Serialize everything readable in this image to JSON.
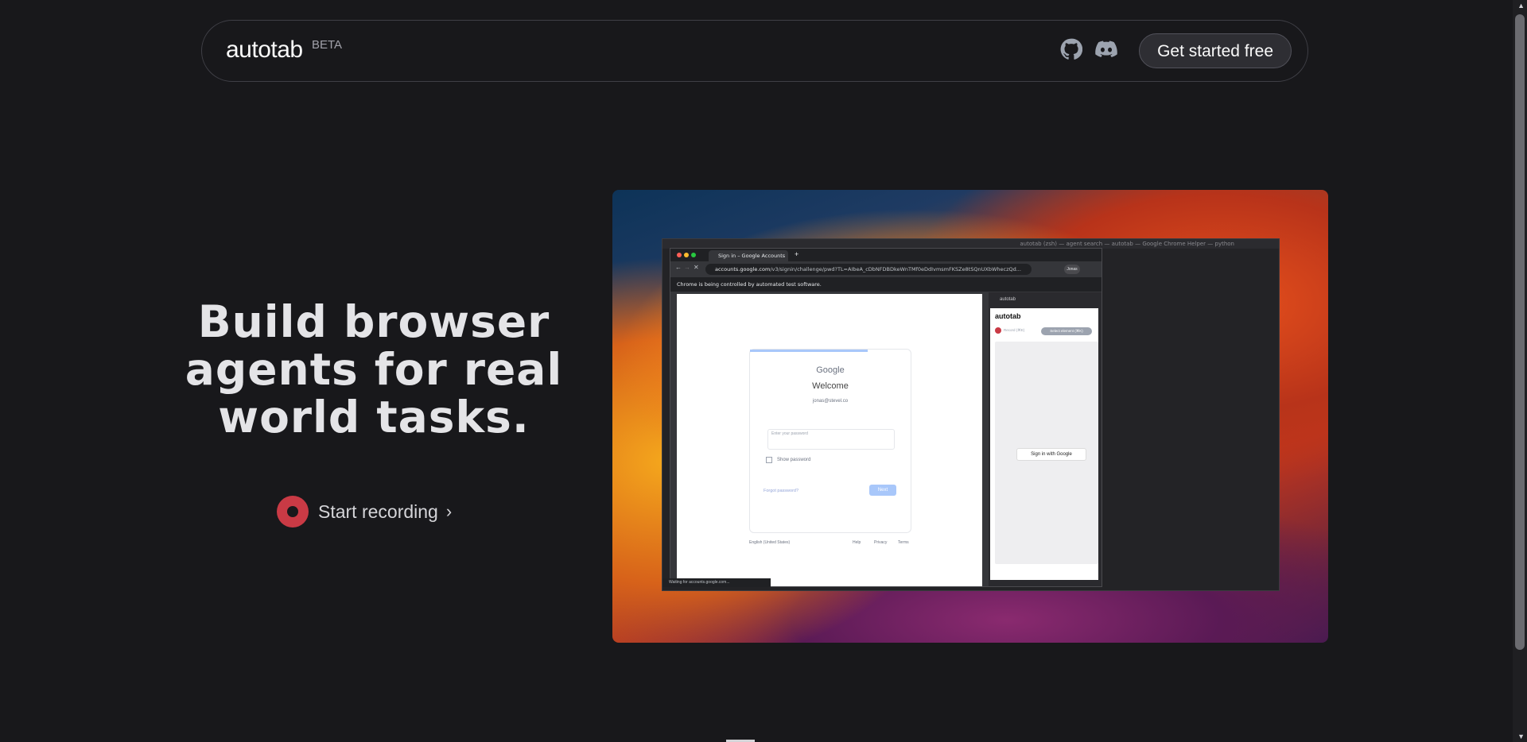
{
  "nav": {
    "brand": "autotab",
    "beta": "BETA",
    "cta_label": "Get started free",
    "icons": [
      "github-icon",
      "discord-icon"
    ]
  },
  "hero": {
    "line1": "Build browser",
    "line2": "agents for real",
    "line3": "world tasks.",
    "record_label": "Start recording"
  },
  "demo": {
    "window_title": "autotab (zsh) — agent search — autotab — Google Chrome Helper — python",
    "tab_title": "Sign in – Google Accounts",
    "url_host": "accounts.google.com",
    "url_rest": "/v3/signin/challenge/pwd?TL=AIbeA_cDbNFDBDkeWnTMf0eDdIvmsmFKSZe8tSQnUXbWheczQd...",
    "automation_notice": "Chrome is being controlled by automated test software.",
    "profile_label": "Jonas",
    "google": {
      "logo": "Google",
      "welcome": "Welcome",
      "account": "jonas@stevel.co",
      "password_placeholder": "Enter your password",
      "show_password": "Show password",
      "forgot": "Forgot password?",
      "next": "Next",
      "language": "English (United States)",
      "help": "Help",
      "privacy": "Privacy",
      "terms": "Terms"
    },
    "side_panel": {
      "tab_label": "autotab",
      "title": "autotab",
      "record": "Record (⌘E)",
      "select": "Select element (⌘K)",
      "google_button": "Sign in with Google"
    },
    "status": "Waiting for accounts.google.com..."
  },
  "colors": {
    "background": "#18181b",
    "record_red": "#c93a45",
    "border": "#3f3f46"
  }
}
